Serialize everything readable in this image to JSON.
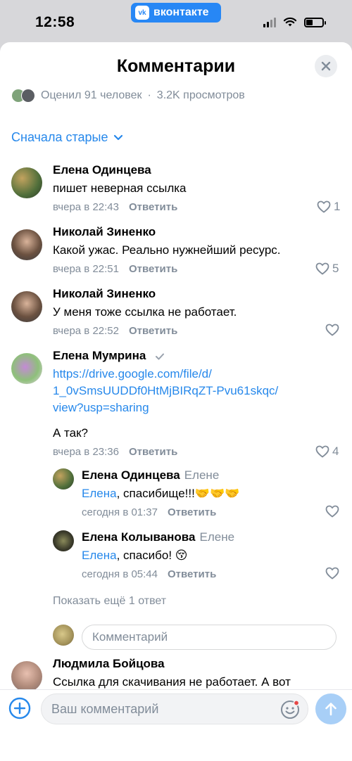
{
  "status_bar": {
    "time": "12:58",
    "app_badge": "вконтакте",
    "vk_logo": "vk"
  },
  "header": {
    "title": "Комментарии",
    "close_icon": "close-icon"
  },
  "stats": {
    "rated": "Оценил 91 человек",
    "separator": "·",
    "views": "3.2K просмотров"
  },
  "sort": {
    "label": "Сначала старые"
  },
  "comments": [
    {
      "name": "Елена Одинцева",
      "text": "пишет неверная ссылка",
      "time": "вчера в 22:43",
      "reply": "Ответить",
      "likes": "1"
    },
    {
      "name": "Николай Зиненко",
      "text": "Какой ужас. Реально нужнейший ресурс.",
      "time": "вчера в 22:51",
      "reply": "Ответить",
      "likes": "5"
    },
    {
      "name": "Николай Зиненко",
      "text": "У меня тоже ссылка не работает.",
      "time": "вчера в 22:52",
      "reply": "Ответить",
      "likes": ""
    },
    {
      "name": "Елена Мумрина",
      "link_lines": [
        "https://drive.google.com/file/d/",
        "1_0vSmsUUDDf0HtMjBIRqZT-Pvu61skqc/",
        "view?usp=sharing"
      ],
      "text": "А так?",
      "time": "вчера в 23:36",
      "reply": "Ответить",
      "likes": "4",
      "replies": [
        {
          "name": "Елена Одинцева",
          "reply_to": "Елене",
          "mention": "Елена",
          "text": ", спасибище!!!🤝🤝🤝",
          "time": "сегодня в 01:37",
          "reply": "Ответить"
        },
        {
          "name": "Елена Колыванова",
          "reply_to": "Елене",
          "mention": "Елена",
          "text": ", спасибо! 😚",
          "time": "сегодня в 05:44",
          "reply": "Ответить"
        }
      ],
      "show_more": "Показать ещё 1 ответ",
      "reply_placeholder": "Комментарий"
    },
    {
      "name": "Людмила Бойцова",
      "text": "Ссылка для скачивания не работает. А вот"
    }
  ],
  "composer": {
    "placeholder": "Ваш комментарий"
  },
  "colors": {
    "accent": "#2688eb",
    "muted": "#818c99",
    "send_disabled": "#a8cff7",
    "vk_blue": "#2787f5"
  }
}
